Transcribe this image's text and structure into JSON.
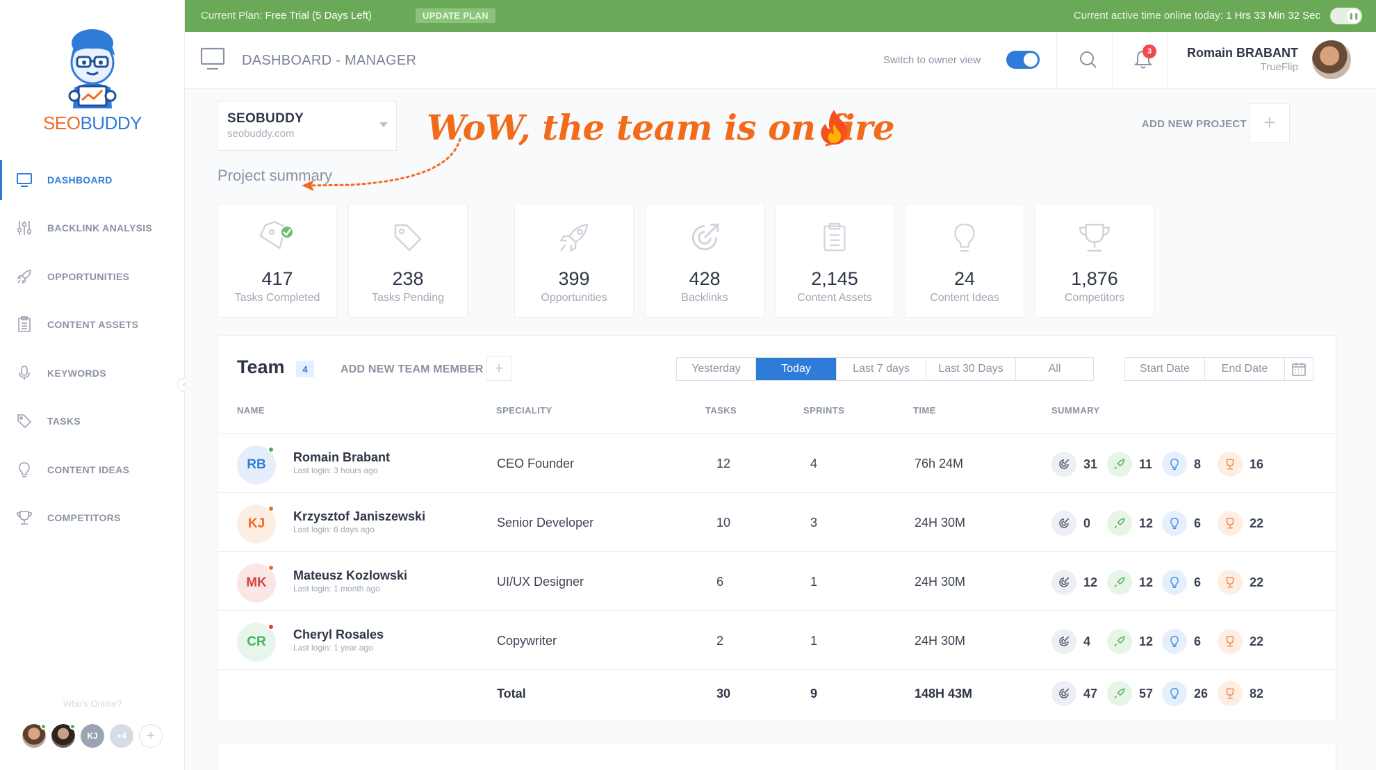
{
  "topbar": {
    "plan_prefix": "Current Plan:",
    "plan_value": "Free Trial (5 Days Left)",
    "upgrade_label": "UPDATE PLAN",
    "active_prefix": "Current active time online today:",
    "active_value": "1 Hrs 33 Min 32 Sec"
  },
  "brand": {
    "seo": "SEO",
    "buddy": "BUDDY"
  },
  "sidebar": {
    "items": [
      {
        "label": "DASHBOARD",
        "icon": "monitor-icon",
        "active": true
      },
      {
        "label": "BACKLINK ANALYSIS",
        "icon": "sliders-icon"
      },
      {
        "label": "OPPORTUNITIES",
        "icon": "rocket-icon"
      },
      {
        "label": "CONTENT ASSETS",
        "icon": "clipboard-icon"
      },
      {
        "label": "KEYWORDS",
        "icon": "microphone-icon"
      },
      {
        "label": "TASKS",
        "icon": "tag-icon"
      },
      {
        "label": "CONTENT IDEAS",
        "icon": "lightbulb-icon"
      },
      {
        "label": "COMPETITORS",
        "icon": "trophy-icon"
      }
    ],
    "online_title": "Who's Online?",
    "online": [
      {
        "type": "photo"
      },
      {
        "type": "photo"
      },
      {
        "initials": "KJ"
      },
      {
        "initials": "+4"
      }
    ]
  },
  "header": {
    "title": "DASHBOARD - MANAGER",
    "switch_label": "Switch to owner view",
    "notifications": "3",
    "user_name": "Romain BRABANT",
    "user_company": "TrueFlip"
  },
  "project": {
    "name": "SEOBUDDY",
    "url": "seobuddy.com",
    "annotation": "WoW, the team is on fire",
    "add_label": "ADD NEW PROJECT",
    "summary_title": "Project summary"
  },
  "cards": [
    {
      "value": "417",
      "label": "Tasks Completed",
      "icon": "tag-check-icon"
    },
    {
      "value": "238",
      "label": "Tasks Pending",
      "icon": "tag-icon"
    },
    {
      "value": "399",
      "label": "Opportunities",
      "icon": "rocket-icon"
    },
    {
      "value": "428",
      "label": "Backlinks",
      "icon": "backlink-icon"
    },
    {
      "value": "2,145",
      "label": "Content Assets",
      "icon": "clipboard-icon"
    },
    {
      "value": "24",
      "label": "Content Ideas",
      "icon": "lightbulb-icon"
    },
    {
      "value": "1,876",
      "label": "Competitors",
      "icon": "trophy-icon"
    }
  ],
  "team": {
    "title": "Team",
    "count": "4",
    "add_label": "ADD NEW TEAM MEMBER",
    "ranges": [
      "Yesterday",
      "Today",
      "Last 7 days",
      "Last 30 Days",
      "All"
    ],
    "active_range": "Today",
    "start_date": "Start Date",
    "end_date": "End Date",
    "columns": [
      "NAME",
      "SPECIALITY",
      "TASKS",
      "SPRINTS",
      "TIME",
      "SUMMARY"
    ],
    "members": [
      {
        "initials": "RB",
        "name": "Romain Brabant",
        "login": "Last login: 3 hours ago",
        "speciality": "CEO Founder",
        "tasks": "12",
        "sprints": "4",
        "time": "76h 24M",
        "backlinks": "31",
        "opportunities": "11",
        "ideas": "8",
        "competitors": "16",
        "status": "#43b25c",
        "av_bg": "#e6eefb",
        "av_fg": "#2f7bd8"
      },
      {
        "initials": "KJ",
        "name": "Krzysztof Janiszewski",
        "login": "Last login: 6 days ago",
        "speciality": "Senior Developer",
        "tasks": "10",
        "sprints": "3",
        "time": "24H 30M",
        "backlinks": "0",
        "opportunities": "12",
        "ideas": "6",
        "competitors": "22",
        "status": "#f26b1b",
        "av_bg": "#fdeee4",
        "av_fg": "#f06a22"
      },
      {
        "initials": "MK",
        "name": "Mateusz Kozlowski",
        "login": "Last login: 1 month ago",
        "speciality": "UI/UX Designer",
        "tasks": "6",
        "sprints": "1",
        "time": "24H 30M",
        "backlinks": "12",
        "opportunities": "12",
        "ideas": "6",
        "competitors": "22",
        "status": "#f26b1b",
        "av_bg": "#fbe6e6",
        "av_fg": "#d64545"
      },
      {
        "initials": "CR",
        "name": "Cheryl Rosales",
        "login": "Last login: 1 year ago",
        "speciality": "Copywriter",
        "tasks": "2",
        "sprints": "1",
        "time": "24H 30M",
        "backlinks": "4",
        "opportunities": "12",
        "ideas": "6",
        "competitors": "22",
        "status": "#e23b3b",
        "av_bg": "#e8f5ea",
        "av_fg": "#43b25c"
      }
    ],
    "total": {
      "label": "Total",
      "tasks": "30",
      "sprints": "9",
      "time": "148H 43M",
      "backlinks": "47",
      "opportunities": "57",
      "ideas": "26",
      "competitors": "82"
    }
  },
  "colors": {
    "brand_blue": "#2f7bd8",
    "brand_orange": "#f26b1b",
    "topbar_green": "#6aa957"
  }
}
